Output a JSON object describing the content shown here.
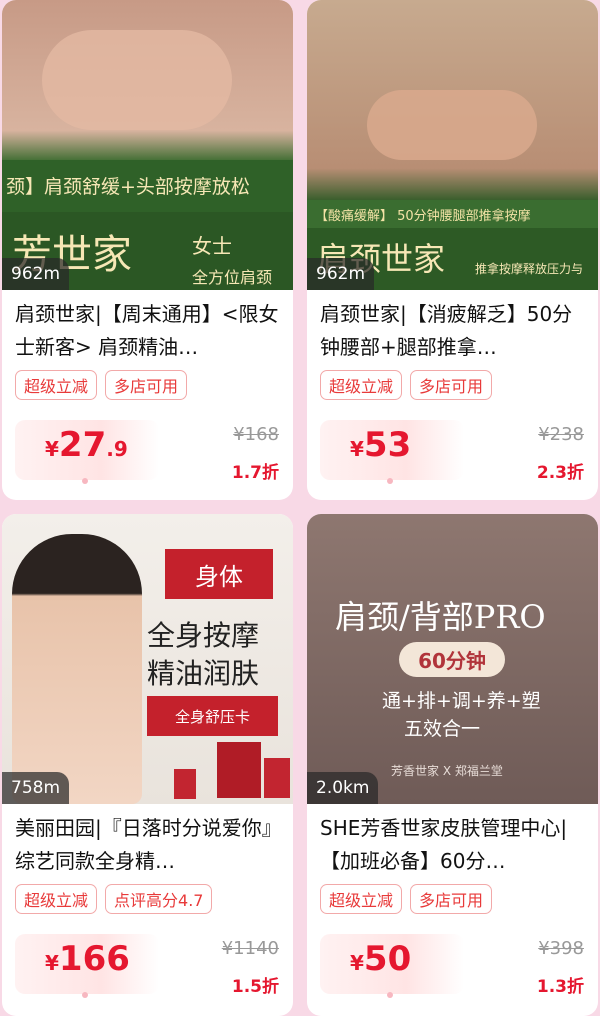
{
  "cards": [
    {
      "distance": "962m",
      "title": "肩颈世家|【周末通用】<限女士新客> 肩颈精油…",
      "tags": [
        "超级立减",
        "多店可用"
      ],
      "price": {
        "yen": "¥",
        "int": "27",
        "dec": ".9"
      },
      "original_price": "¥168",
      "discount": "1.7折",
      "poster": {
        "banner1": "颈】肩颈舒缓+头部按摩放松",
        "brand": "芳世家",
        "tag1": "女士",
        "tag2": "全方位肩颈"
      }
    },
    {
      "distance": "962m",
      "title": "肩颈世家|【消疲解乏】50分钟腰部+腿部推拿…",
      "tags": [
        "超级立减",
        "多店可用"
      ],
      "price": {
        "yen": "¥",
        "int": "53",
        "dec": ""
      },
      "original_price": "¥238",
      "discount": "2.3折",
      "poster": {
        "banner1": "【酸痛缓解】 50分钟腰腿部推拿按摩",
        "brand": "肩颈世家",
        "tag2": "推拿按摩释放压力与"
      }
    },
    {
      "distance": "758m",
      "title": "美丽田园|『日落时分说爱你』综艺同款全身精…",
      "tags": [
        "超级立减",
        "点评高分4.7"
      ],
      "price": {
        "yen": "¥",
        "int": "166",
        "dec": ""
      },
      "original_price": "¥1140",
      "discount": "1.5折",
      "poster": {
        "badge": "身体",
        "line1": "全身按摩",
        "line2": "精油润肤",
        "band": "全身舒压卡"
      }
    },
    {
      "distance": "2.0km",
      "title": "SHE芳香世家皮肤管理中心|【加班必备】60分…",
      "tags": [
        "超级立减",
        "多店可用"
      ],
      "price": {
        "yen": "¥",
        "int": "50",
        "dec": ""
      },
      "original_price": "¥398",
      "discount": "1.3折",
      "poster": {
        "heading": "肩颈/背部PRO",
        "pill": "60分钟",
        "line1": "通+排+调+养+塑",
        "line2": "五效合一",
        "footer": "芳香世家 X 郑福兰堂"
      }
    }
  ]
}
